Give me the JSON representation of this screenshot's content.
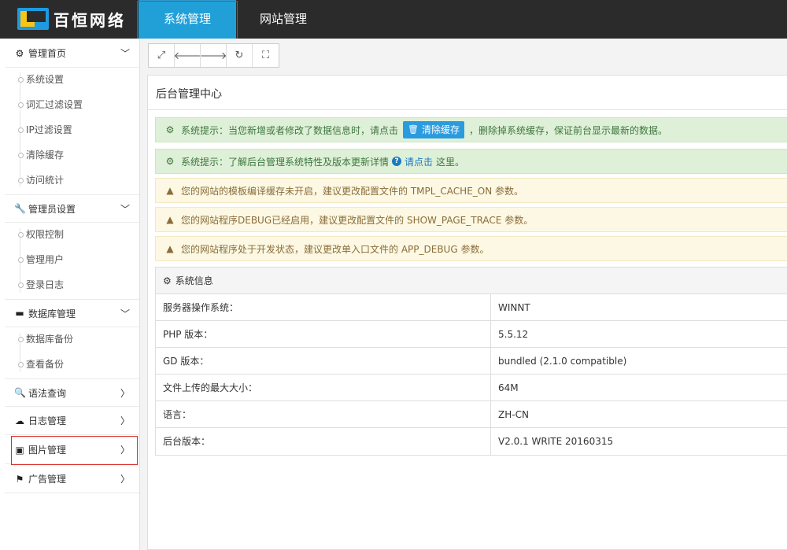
{
  "brand": {
    "name": "百恒网络"
  },
  "topnav": [
    {
      "label": "系统管理",
      "active": true
    },
    {
      "label": "网站管理",
      "active": false
    }
  ],
  "sidebar": {
    "groups": [
      {
        "label": "管理首页",
        "icon": "gear-icon",
        "expanded": true,
        "items": [
          "系统设置",
          "词汇过滤设置",
          "IP过滤设置",
          "清除缓存",
          "访问统计"
        ]
      },
      {
        "label": "管理员设置",
        "icon": "wrench-icon",
        "expanded": true,
        "items": [
          "权限控制",
          "管理用户",
          "登录日志"
        ]
      },
      {
        "label": "数据库管理",
        "icon": "hdd-icon",
        "expanded": true,
        "items": [
          "数据库备份",
          "查看备份"
        ]
      },
      {
        "label": "语法查询",
        "icon": "search-icon",
        "expanded": false,
        "items": []
      },
      {
        "label": "日志管理",
        "icon": "cloud-icon",
        "expanded": false,
        "items": []
      },
      {
        "label": "图片管理",
        "icon": "picture-icon",
        "expanded": false,
        "items": []
      },
      {
        "label": "广告管理",
        "icon": "flag-icon",
        "expanded": false,
        "items": []
      }
    ]
  },
  "toolbar": {
    "buttons": [
      {
        "name": "expand-icon",
        "glyph": "⤢"
      },
      {
        "name": "arrow-left-icon",
        "glyph": "🡐"
      },
      {
        "name": "arrow-right-icon",
        "glyph": "🡒"
      },
      {
        "name": "refresh-icon",
        "glyph": "↻"
      },
      {
        "name": "fullscreen-icon",
        "glyph": "⛶"
      }
    ]
  },
  "panel": {
    "title": "后台管理中心",
    "alerts": {
      "cache": {
        "prefix": "系统提示：当您新增或者修改了数据信息时，请点击",
        "button": "清除缓存",
        "suffix": "，删除掉系统缓存，保证前台显示最新的数据。"
      },
      "update": {
        "prefix": "系统提示：了解后台管理系统特性及版本更新详情",
        "link": "请点击",
        "suffix": "这里。"
      },
      "warnings": [
        "您的网站的模板编译缓存未开启，建议更改配置文件的 TMPL_CACHE_ON 参数。",
        "您的网站程序DEBUG已经启用，建议更改配置文件的 SHOW_PAGE_TRACE 参数。",
        "您的网站程序处于开发状态，建议更改单入口文件的 APP_DEBUG 参数。"
      ]
    },
    "sysinfo": {
      "title": "系统信息",
      "rows": [
        {
          "k": "服务器操作系统：",
          "v": "WINNT"
        },
        {
          "k": "PHP 版本：",
          "v": "5.5.12"
        },
        {
          "k": "GD 版本：",
          "v": "bundled (2.1.0 compatible)"
        },
        {
          "k": "文件上传的最大大小：",
          "v": "64M"
        },
        {
          "k": "语言：",
          "v": "ZH-CN"
        },
        {
          "k": "后台版本：",
          "v": "V2.0.1 WRITE 20160315"
        }
      ]
    }
  },
  "colors": {
    "accent": "#21a0d8",
    "topbar": "#2b2b2b",
    "highlight": "#d9302b"
  }
}
